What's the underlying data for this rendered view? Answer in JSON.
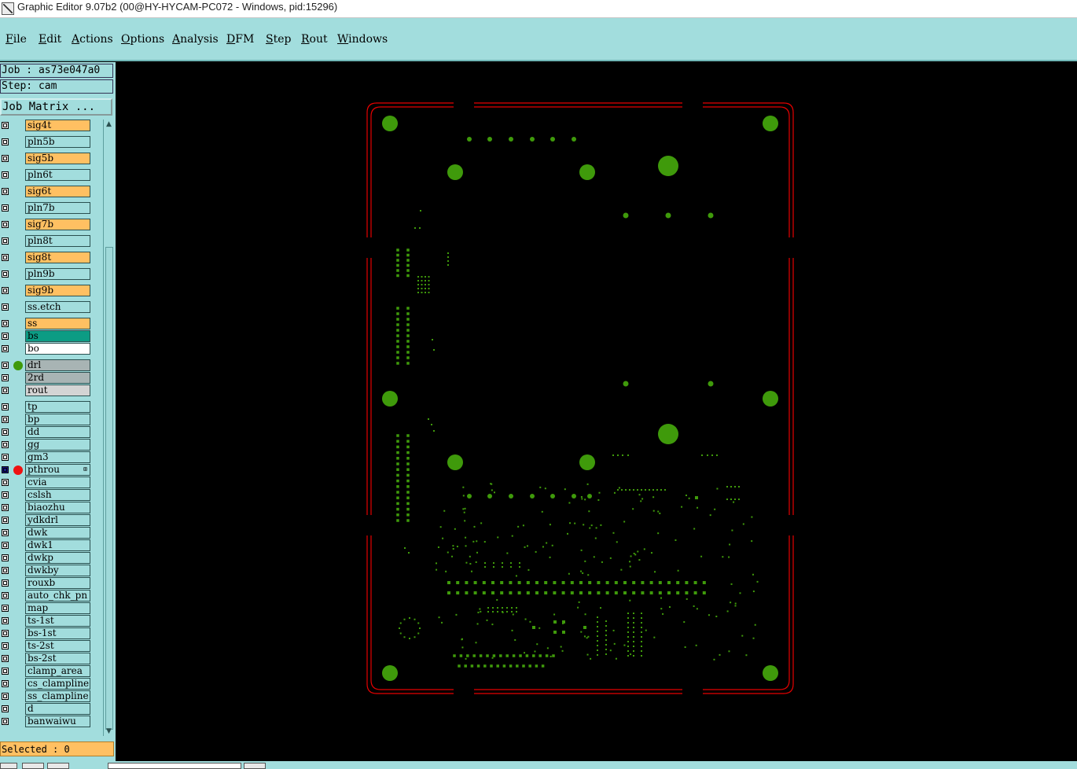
{
  "window": {
    "title": "Graphic Editor 9.07b2 (00@HY-HYCAM-PC072 - Windows, pid:15296)",
    "app_icon": "graphic-editor-icon"
  },
  "menu": [
    {
      "label": "File"
    },
    {
      "label": "Edit"
    },
    {
      "label": "Actions"
    },
    {
      "label": "Options"
    },
    {
      "label": "Analysis"
    },
    {
      "label": "DFM"
    },
    {
      "label": "Step"
    },
    {
      "label": "Rout"
    },
    {
      "label": "Windows"
    }
  ],
  "job_info": {
    "job": "Job : as73e047a0",
    "step": "Step: cam",
    "job_matrix_button": "Job Matrix ..."
  },
  "colors": {
    "signal_layer": "#ffc062",
    "plane_layer": "#a2dddd",
    "solder_mask_layer": "#0c9c84",
    "drill_layer": "#a8b4b4",
    "rout_layer": "#d4d4d4",
    "profile_outline": "#e60000",
    "pad_fill": "#3f9a0b",
    "canvas_bg": "#000000",
    "panel_bg": "#a2dddd"
  },
  "layers": [
    {
      "name": "sig4t",
      "type": "signal"
    },
    {
      "name": "pln5b",
      "type": "plane"
    },
    {
      "name": "sig5b",
      "type": "signal"
    },
    {
      "name": "pln6t",
      "type": "plane"
    },
    {
      "name": "sig6t",
      "type": "signal"
    },
    {
      "name": "pln7b",
      "type": "plane"
    },
    {
      "name": "sig7b",
      "type": "signal"
    },
    {
      "name": "pln8t",
      "type": "plane"
    },
    {
      "name": "sig8t",
      "type": "signal"
    },
    {
      "name": "pln9b",
      "type": "plane"
    },
    {
      "name": "sig9b",
      "type": "signal"
    },
    {
      "name": "ss.etch",
      "type": "plane"
    },
    {
      "name": "ss",
      "type": "signal"
    },
    {
      "name": "bs",
      "type": "mask"
    },
    {
      "name": "bo",
      "type": "white"
    },
    {
      "name": "drl",
      "type": "drill",
      "indicator": "green-dot"
    },
    {
      "name": "2rd",
      "type": "drill"
    },
    {
      "name": "rout",
      "type": "rout"
    },
    {
      "name": "tp",
      "type": "misc"
    },
    {
      "name": "bp",
      "type": "misc"
    },
    {
      "name": "dd",
      "type": "misc"
    },
    {
      "name": "gg",
      "type": "misc"
    },
    {
      "name": "gm3",
      "type": "misc"
    },
    {
      "name": "pthrou",
      "type": "misc",
      "indicator": "red-dot",
      "active": true
    },
    {
      "name": "cvia",
      "type": "misc"
    },
    {
      "name": "cslsh",
      "type": "misc"
    },
    {
      "name": "biaozhu",
      "type": "misc"
    },
    {
      "name": "ydkdrl",
      "type": "misc"
    },
    {
      "name": "dwk",
      "type": "misc"
    },
    {
      "name": "dwk1",
      "type": "misc"
    },
    {
      "name": "dwkp",
      "type": "misc"
    },
    {
      "name": "dwkby",
      "type": "misc"
    },
    {
      "name": "rouxb",
      "type": "misc"
    },
    {
      "name": "auto_chk_pn",
      "type": "misc"
    },
    {
      "name": "map",
      "type": "misc"
    },
    {
      "name": "ts-1st",
      "type": "misc"
    },
    {
      "name": "bs-1st",
      "type": "misc"
    },
    {
      "name": "ts-2st",
      "type": "misc"
    },
    {
      "name": "bs-2st",
      "type": "misc"
    },
    {
      "name": "clamp_area",
      "type": "misc"
    },
    {
      "name": "cs_clampline",
      "type": "misc"
    },
    {
      "name": "ss_clampline",
      "type": "misc"
    },
    {
      "name": "d",
      "type": "misc"
    },
    {
      "name": "banwaiwu",
      "type": "misc"
    }
  ],
  "status": {
    "selected": "Selected : 0"
  }
}
